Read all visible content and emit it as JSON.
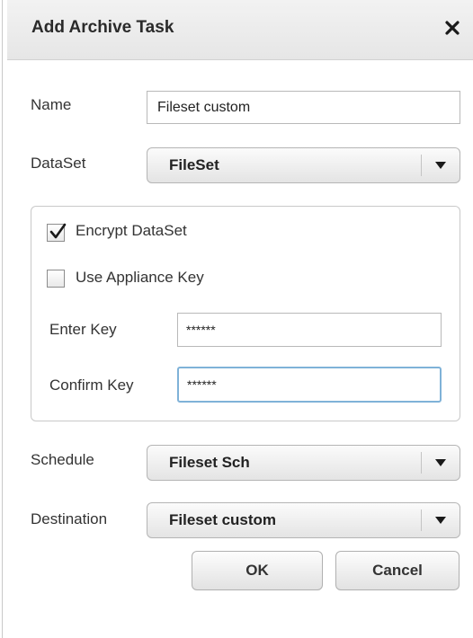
{
  "dialog": {
    "title": "Add Archive Task",
    "close_icon": "close-icon"
  },
  "form": {
    "name_label": "Name",
    "name_value": "Fileset custom",
    "dataset_label": "DataSet",
    "dataset_value": "FileSet",
    "schedule_label": "Schedule",
    "schedule_value": "Fileset Sch",
    "destination_label": "Destination",
    "destination_value": "Fileset custom"
  },
  "encryption": {
    "encrypt_label": "Encrypt DataSet",
    "encrypt_checked": true,
    "appliance_label": "Use Appliance Key",
    "appliance_checked": false,
    "enter_key_label": "Enter Key",
    "enter_key_value": "******",
    "confirm_key_label": "Confirm Key",
    "confirm_key_value": "******"
  },
  "buttons": {
    "ok_label": "OK",
    "cancel_label": "Cancel"
  },
  "colors": {
    "focus_border": "#7fb2d8",
    "title_bg": "#ececec"
  }
}
